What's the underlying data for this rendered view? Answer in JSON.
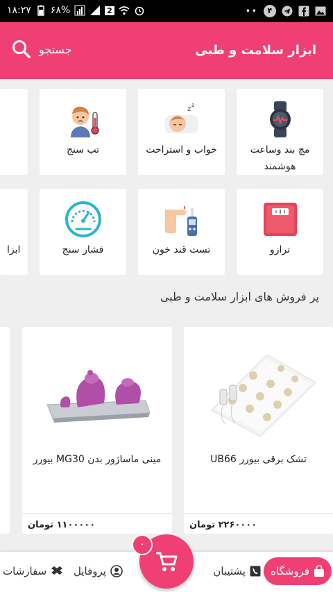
{
  "status_bar": {
    "time": "۱۸:۲۷",
    "battery": "۶۸%",
    "sim_badge": "2",
    "notif_count": "۴"
  },
  "app_bar": {
    "title": "ابزار سلامت و طبی",
    "search_label": "جستجو"
  },
  "categories_row1": [
    {
      "label": "مچ بند وساعت هوشمند",
      "icon": "smartwatch-icon"
    },
    {
      "label": "خواب و استراحت",
      "icon": "sleep-icon"
    },
    {
      "label": "تب سنج",
      "icon": "thermometer-icon"
    }
  ],
  "categories_row2": [
    {
      "label": "ترازو",
      "icon": "scale-icon"
    },
    {
      "label": "تست قند خون",
      "icon": "glucometer-icon"
    },
    {
      "label": "فشار سنج",
      "icon": "pressure-gauge-icon"
    },
    {
      "label": "ابزا"
    }
  ],
  "section_title": "پر فروش های ابزار سلامت و طبی",
  "products": [
    {
      "name": "تشک برقی بیورر UB66",
      "price": "۲۲۶۰۰۰۰ تومان"
    },
    {
      "name": "مینی ماساژور بدن MG30 بیورر",
      "price": "۱۱۰۰۰۰۰ تومان"
    }
  ],
  "bottom_nav": {
    "store": "فروشگاه",
    "support": "پشتیبان",
    "profile": "پروفایل",
    "orders": "سفارشات",
    "cart_badge": "۰"
  },
  "colors": {
    "accent": "#ef3f73"
  }
}
